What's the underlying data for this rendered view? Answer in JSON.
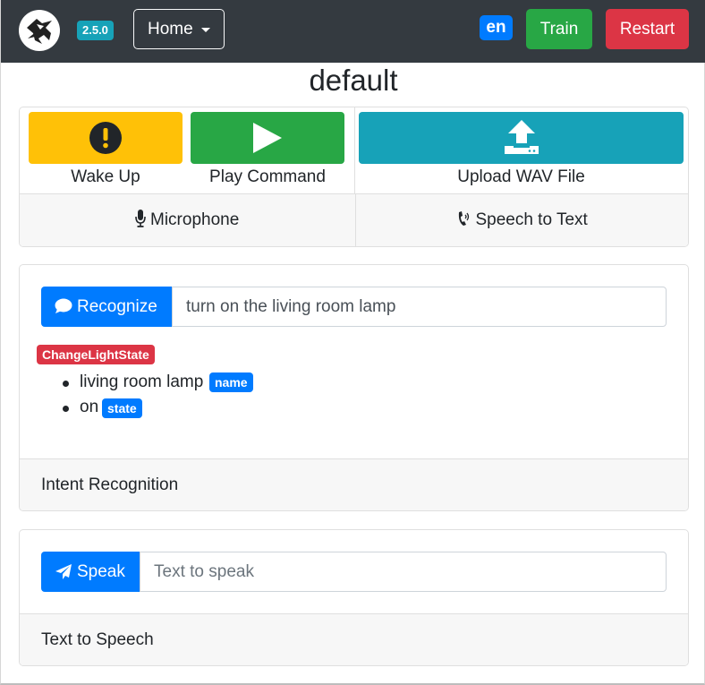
{
  "navbar": {
    "version": "2.5.0",
    "home_label": "Home",
    "language": "en",
    "train_label": "Train",
    "restart_label": "Restart"
  },
  "profile_name": "default",
  "audio": {
    "wake_label": "Wake Up",
    "play_label": "Play Command",
    "upload_label": "Upload WAV File",
    "microphone_label": "Microphone",
    "stt_label": "Speech to Text"
  },
  "recognize": {
    "button_label": "Recognize",
    "input_value": "turn on the living room lamp",
    "intent_name": "ChangeLightState",
    "slots": [
      {
        "value": "living room lamp",
        "name": "name"
      },
      {
        "value": "on",
        "name": "state"
      }
    ],
    "footer": "Intent Recognition"
  },
  "speak": {
    "button_label": "Speak",
    "input_placeholder": "Text to speak",
    "footer": "Text to Speech"
  },
  "colors": {
    "navbar": "#343a40",
    "info": "#17a2b8",
    "primary": "#007bff",
    "success": "#28a745",
    "danger": "#dc3545",
    "warning": "#ffc107"
  },
  "icons": [
    "logo-icon",
    "exclamation-circle-icon",
    "play-icon",
    "upload-icon",
    "microphone-icon",
    "phone-volume-icon",
    "comment-icon",
    "paper-plane-icon"
  ]
}
